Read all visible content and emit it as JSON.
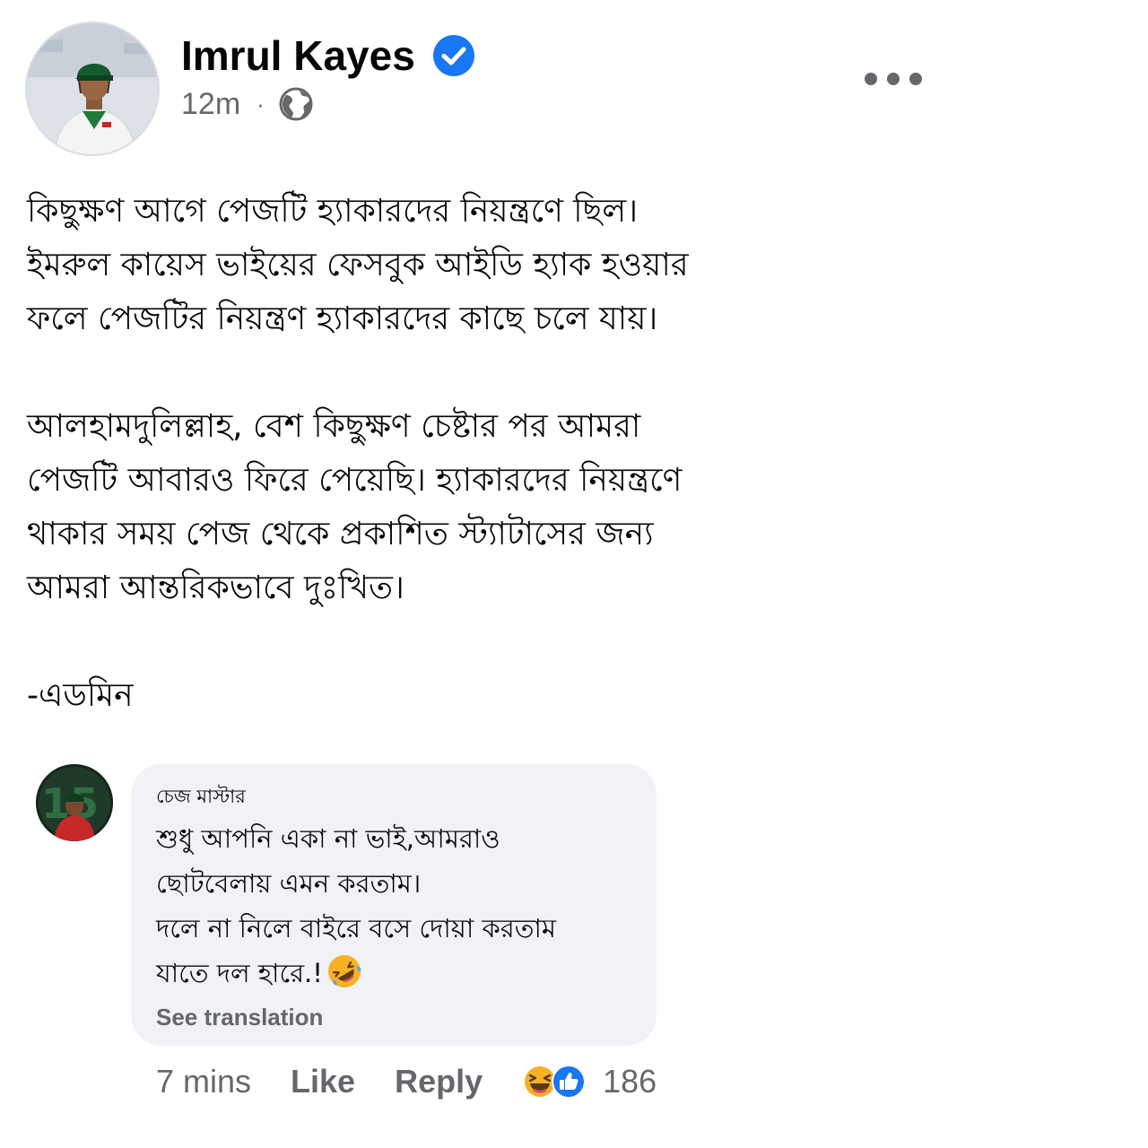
{
  "post": {
    "author_name": "Imrul Kayes",
    "verified": true,
    "timestamp": "12m",
    "separator": "·",
    "privacy_icon": "globe-icon",
    "more_icon": "more-horizontal-icon",
    "body": [
      "কিছুক্ষণ আগে পেজটি হ্যাকারদের নিয়ন্ত্রণে ছিল।",
      "ইমরুল কায়েস ভাইয়ের ফেসবুক আইডি হ্যাক হওয়ার",
      "ফলে পেজটির নিয়ন্ত্রণ হ্যাকারদের কাছে চলে যায়।",
      "আলহামদুলিল্লাহ, বেশ কিছুক্ষণ চেষ্টার পর আমরা",
      "পেজটি আবারও ফিরে পেয়েছি। হ্যাকারদের নিয়ন্ত্রণে",
      "থাকার সময় পেজ থেকে প্রকাশিত স্ট্যাটাসের জন্য",
      "আমরা আন্তরিকভাবে দুঃখিত।",
      "-এডমিন"
    ]
  },
  "comment": {
    "author_name": "চেজ মাস্টার",
    "lines": [
      "শুধু আপনি একা না ভাই,আমরাও",
      "ছোটবেলায় এমন করতাম।",
      "দলে না নিলে বাইরে বসে দোয়া করতাম",
      "যাতে দল হারে.!"
    ],
    "emoji": "rolling-on-floor-laughing-emoji",
    "see_translation": "See translation",
    "time": "7 mins",
    "like_label": "Like",
    "reply_label": "Reply",
    "reaction_icons": [
      "haha-reaction-icon",
      "like-reaction-icon"
    ],
    "reaction_count": "186"
  },
  "colors": {
    "text_primary": "#050505",
    "text_secondary": "#65676b",
    "verified_blue": "#1877f2",
    "bubble_bg": "#f0f2f5",
    "haha_yellow": "#f7b125",
    "like_blue": "#1877f2"
  }
}
